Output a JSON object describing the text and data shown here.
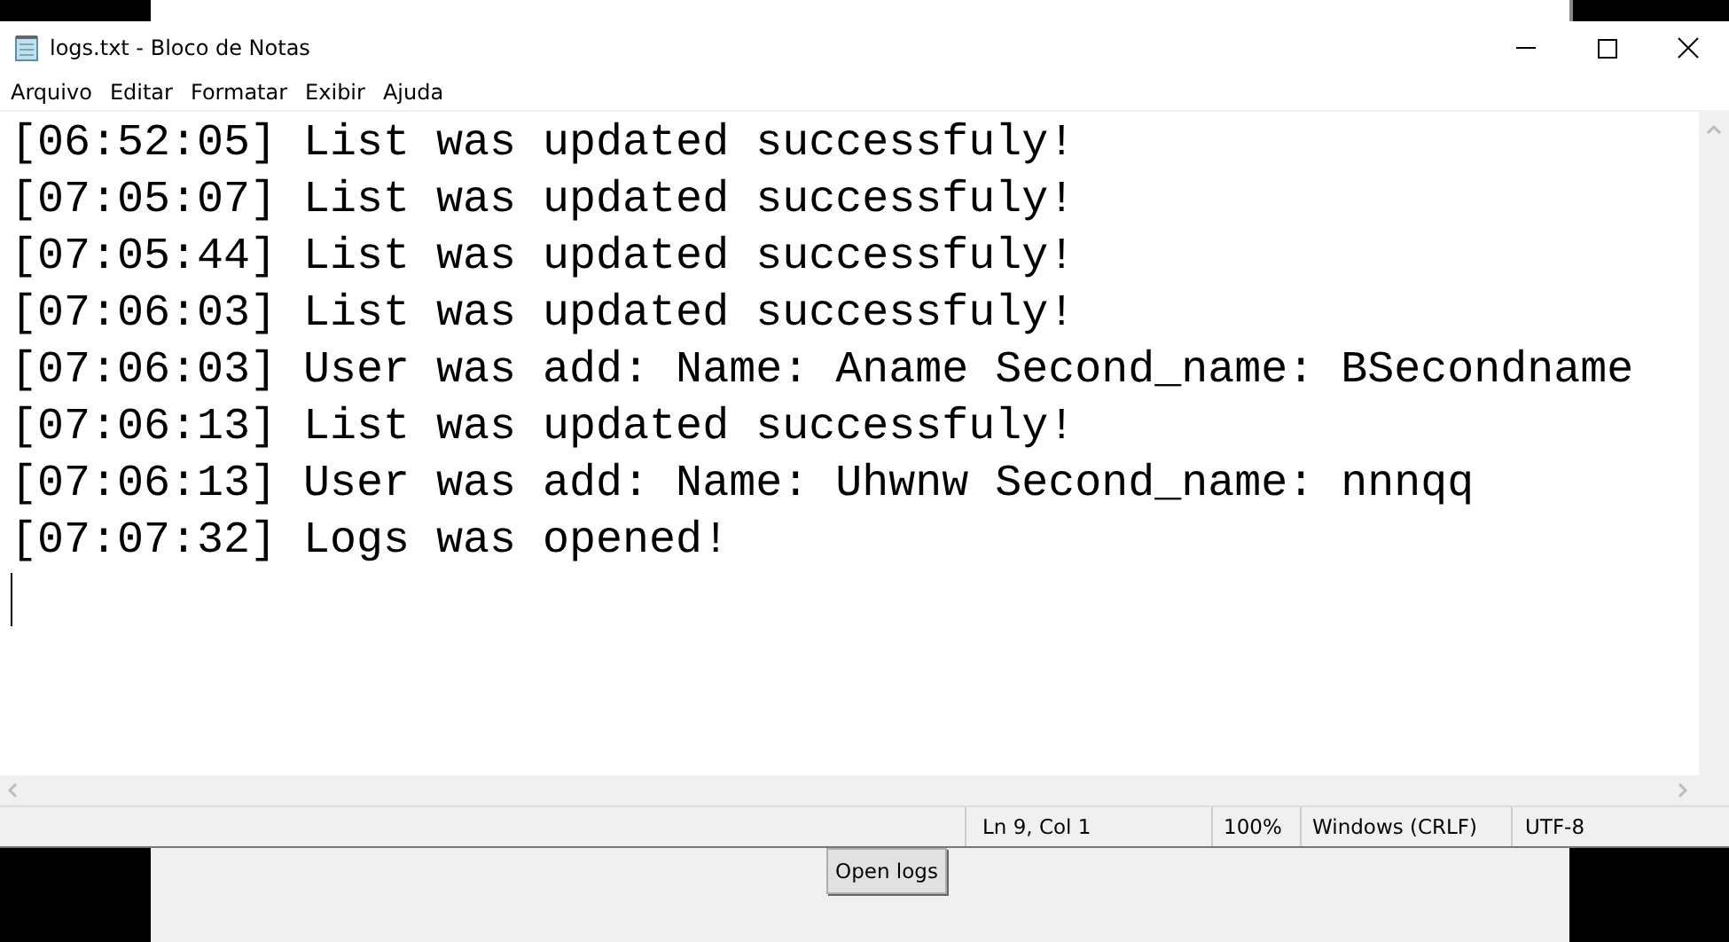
{
  "window": {
    "title": "logs.txt - Bloco de Notas"
  },
  "menu": [
    "Arquivo",
    "Editar",
    "Formatar",
    "Exibir",
    "Ajuda"
  ],
  "editor": {
    "lines": [
      "[06:52:05] List was updated successfuly!",
      "[07:05:07] List was updated successfuly!",
      "[07:05:44] List was updated successfuly!",
      "[07:06:03] List was updated successfuly!",
      "[07:06:03] User was add: Name: Aname Second_name: BSecondname",
      "[07:06:13] List was updated successfuly!",
      "[07:06:13] User was add: Name: Uhwnw Second_name: nnnqq",
      "[07:07:32] Logs was opened!"
    ]
  },
  "status_bar": [
    "Ln 9, Col 1",
    "100%",
    "Windows (CRLF)",
    "UTF-8"
  ],
  "background_window": {
    "button": "Open logs"
  }
}
